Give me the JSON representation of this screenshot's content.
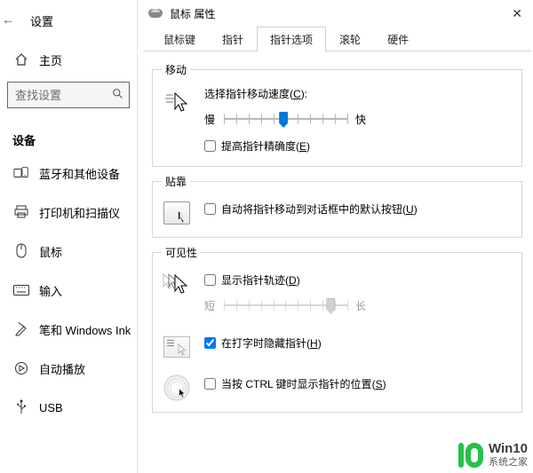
{
  "settings": {
    "title": "设置",
    "home": "主页",
    "search_placeholder": "查找设置",
    "section": "设备",
    "items": [
      {
        "label": "蓝牙和其他设备",
        "icon": "bluetooth-devices-icon"
      },
      {
        "label": "打印机和扫描仪",
        "icon": "printer-icon"
      },
      {
        "label": "鼠标",
        "icon": "mouse-icon"
      },
      {
        "label": "输入",
        "icon": "keyboard-icon"
      },
      {
        "label": "笔和 Windows Ink",
        "icon": "pen-icon"
      },
      {
        "label": "自动播放",
        "icon": "autoplay-icon"
      },
      {
        "label": "USB",
        "icon": "usb-icon"
      }
    ]
  },
  "dialog": {
    "title": "鼠标 属性",
    "tabs": {
      "t0": "鼠标键",
      "t1": "指针",
      "t2": "指针选项",
      "t3": "滚轮",
      "t4": "硬件"
    },
    "active_tab": 2,
    "motion": {
      "legend": "移动",
      "speed_label": "选择指针移动速度",
      "speed_key": "C",
      "slow": "慢",
      "fast": "快",
      "speed_value_pct": 48,
      "enhance_label": "提高指针精确度",
      "enhance_key": "E",
      "enhance_checked": false
    },
    "snap": {
      "legend": "贴靠",
      "label": "自动将指针移动到对话框中的默认按钮",
      "key": "U",
      "checked": false
    },
    "visibility": {
      "legend": "可见性",
      "trail_label": "显示指针轨迹",
      "trail_key": "D",
      "trail_checked": false,
      "trail_short": "短",
      "trail_long": "长",
      "trail_value_pct": 86,
      "hide_label": "在打字时隐藏指针",
      "hide_key": "H",
      "hide_checked": true,
      "locate_label": "当按 CTRL 键时显示指针的位置",
      "locate_key": "S",
      "locate_checked": false
    }
  },
  "watermark": {
    "line1": "Win10",
    "line2": "系统之家"
  }
}
